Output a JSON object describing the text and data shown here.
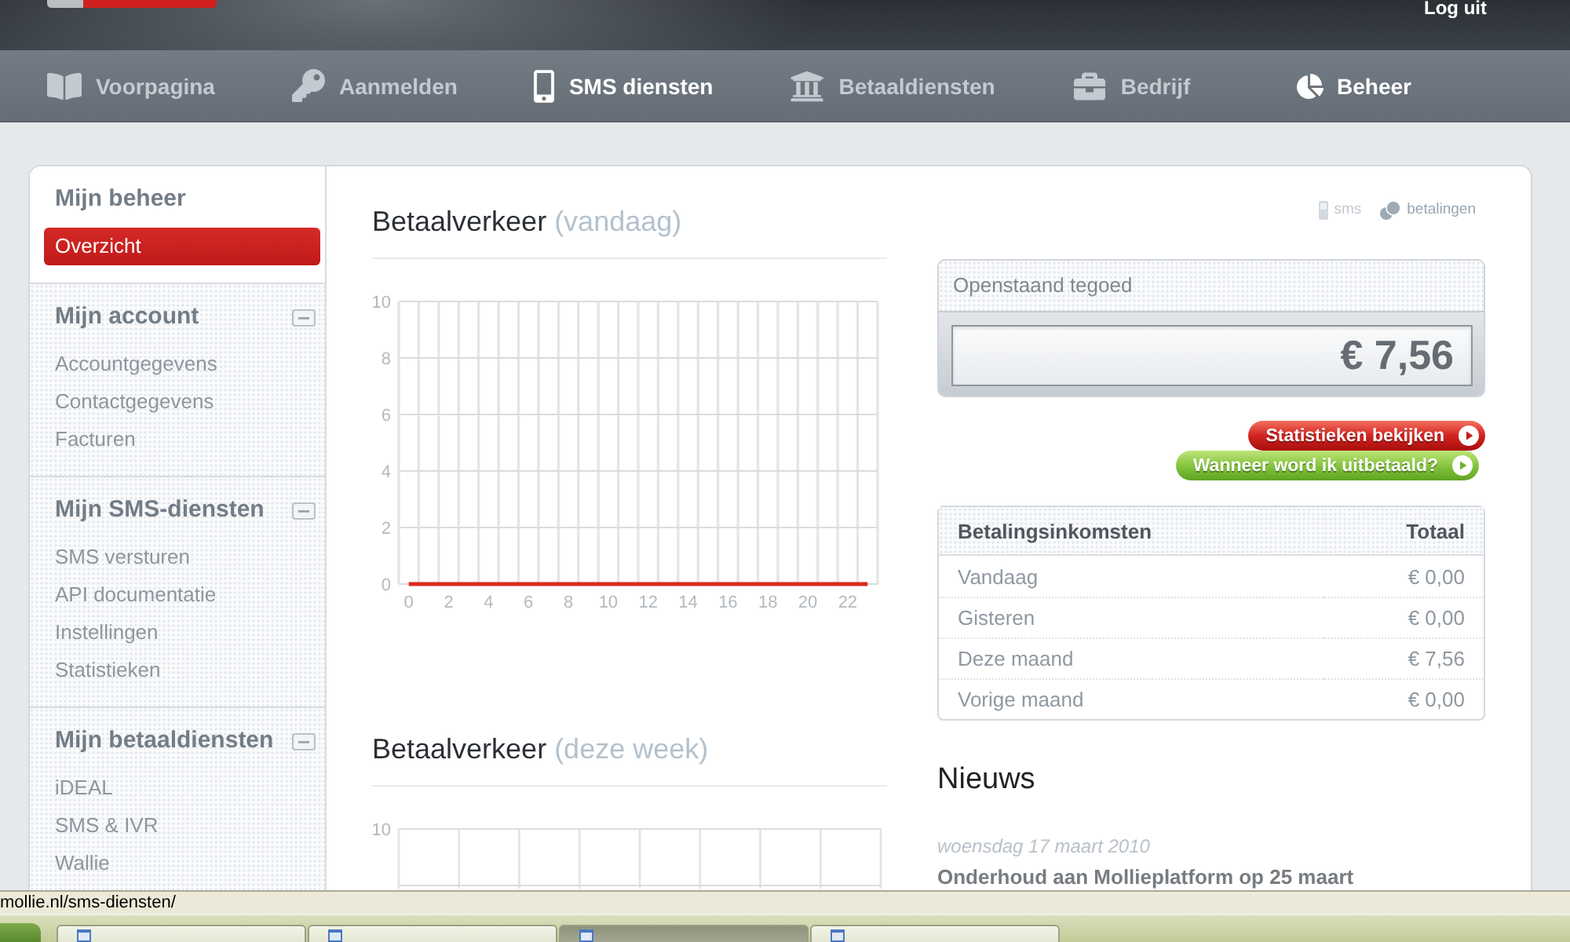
{
  "header": {
    "logout": "Log uit"
  },
  "nav": [
    {
      "label": "Voorpagina",
      "selected": false
    },
    {
      "label": "Aanmelden",
      "selected": false
    },
    {
      "label": "SMS diensten",
      "selected": true
    },
    {
      "label": "Betaaldiensten",
      "selected": false
    },
    {
      "label": "Bedrijf",
      "selected": false
    },
    {
      "label": "Beheer",
      "selected": true
    }
  ],
  "sidebar": {
    "sections": [
      {
        "kind": "main",
        "title": "Mijn beheer",
        "items": [
          {
            "label": "Overzicht",
            "selected": true
          }
        ]
      },
      {
        "kind": "group",
        "title": "Mijn account",
        "expanded": true,
        "items": [
          {
            "label": "Accountgegevens",
            "selected": false
          },
          {
            "label": "Contactgegevens",
            "selected": false
          },
          {
            "label": "Facturen",
            "selected": false
          }
        ]
      },
      {
        "kind": "group",
        "title": "Mijn SMS-diensten",
        "expanded": true,
        "items": [
          {
            "label": "SMS versturen",
            "selected": false
          },
          {
            "label": "API documentatie",
            "selected": false
          },
          {
            "label": "Instellingen",
            "selected": false
          },
          {
            "label": "Statistieken",
            "selected": false
          }
        ]
      },
      {
        "kind": "group",
        "title": "Mijn betaaldiensten",
        "expanded": true,
        "items": [
          {
            "label": "iDEAL",
            "selected": false
          },
          {
            "label": "SMS & IVR",
            "selected": false
          },
          {
            "label": "Wallie",
            "selected": false
          }
        ]
      }
    ]
  },
  "charts": [
    {
      "title": "Betaalverkeer",
      "period": "(vandaag)",
      "chart_data": {
        "type": "line",
        "x": [
          0,
          1,
          2,
          3,
          4,
          5,
          6,
          7,
          8,
          9,
          10,
          11,
          12,
          13,
          14,
          15,
          16,
          17,
          18,
          19,
          20,
          21,
          22,
          23
        ],
        "series": [
          {
            "color": "#d9291c",
            "values": [
              0,
              0,
              0,
              0,
              0,
              0,
              0,
              0,
              0,
              0,
              0,
              0,
              0,
              0,
              0,
              0,
              0,
              0,
              0,
              0,
              0,
              0,
              0,
              0
            ]
          }
        ],
        "xlim": [
          -0.5,
          23.5
        ],
        "ylim": [
          0,
          10
        ],
        "yticks": [
          0,
          2,
          4,
          6,
          8,
          10
        ],
        "xticks": [
          0,
          2,
          4,
          6,
          8,
          10,
          12,
          14,
          16,
          18,
          20,
          22
        ],
        "grid": true
      }
    },
    {
      "title": "Betaalverkeer",
      "period": "(deze week)",
      "axis_label": "10"
    }
  ],
  "legend": [
    {
      "label": "sms",
      "selected": false
    },
    {
      "label": "betalingen",
      "selected": true
    }
  ],
  "balance": {
    "label": "Openstaand tegoed",
    "value": "€ 7,56"
  },
  "actions": [
    {
      "label": "Statistieken bekijken",
      "kind": "primary"
    },
    {
      "label": "Wanneer word ik uitbetaald?",
      "kind": "secondary"
    }
  ],
  "income_table": {
    "columns": [
      "Betalingsinkomsten",
      "Totaal"
    ],
    "rows": [
      [
        "Vandaag",
        "€ 0,00"
      ],
      [
        "Gisteren",
        "€ 0,00"
      ],
      [
        "Deze maand",
        "€ 7,56"
      ],
      [
        "Vorige maand",
        "€ 0,00"
      ]
    ]
  },
  "news": {
    "title": "Nieuws",
    "items": [
      {
        "date": "woensdag 17 maart 2010",
        "title": "Onderhoud aan Mollieplatform op 25 maart"
      }
    ]
  },
  "status_bar": {
    "text": "mollie.nl/sms-diensten/"
  },
  "taskbar": {
    "buttons": [
      {
        "selected": false
      },
      {
        "selected": false
      },
      {
        "selected": true
      },
      {
        "selected": false
      }
    ]
  }
}
